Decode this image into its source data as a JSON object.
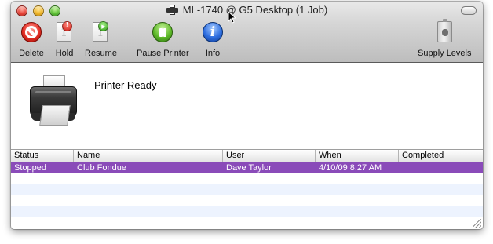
{
  "window": {
    "title": "ML-1740 @ G5 Desktop (1 Job)"
  },
  "toolbar": {
    "delete_label": "Delete",
    "hold_label": "Hold",
    "resume_label": "Resume",
    "pause_label": "Pause Printer",
    "info_label": "Info",
    "supply_label": "Supply Levels",
    "hold_badge": "!",
    "resume_badge": "▶",
    "doc_number": "1"
  },
  "printer": {
    "status": "Printer Ready"
  },
  "jobs": {
    "headers": {
      "status": "Status",
      "name": "Name",
      "user": "User",
      "when": "When",
      "completed": "Completed"
    },
    "rows": [
      {
        "status": "Stopped",
        "name": "Club Fondue",
        "user": "Dave Taylor",
        "when": "4/10/09 8:27 AM",
        "completed": ""
      }
    ]
  },
  "colors": {
    "selection": "#8a4bb9",
    "alt_row": "#edf3fe"
  }
}
